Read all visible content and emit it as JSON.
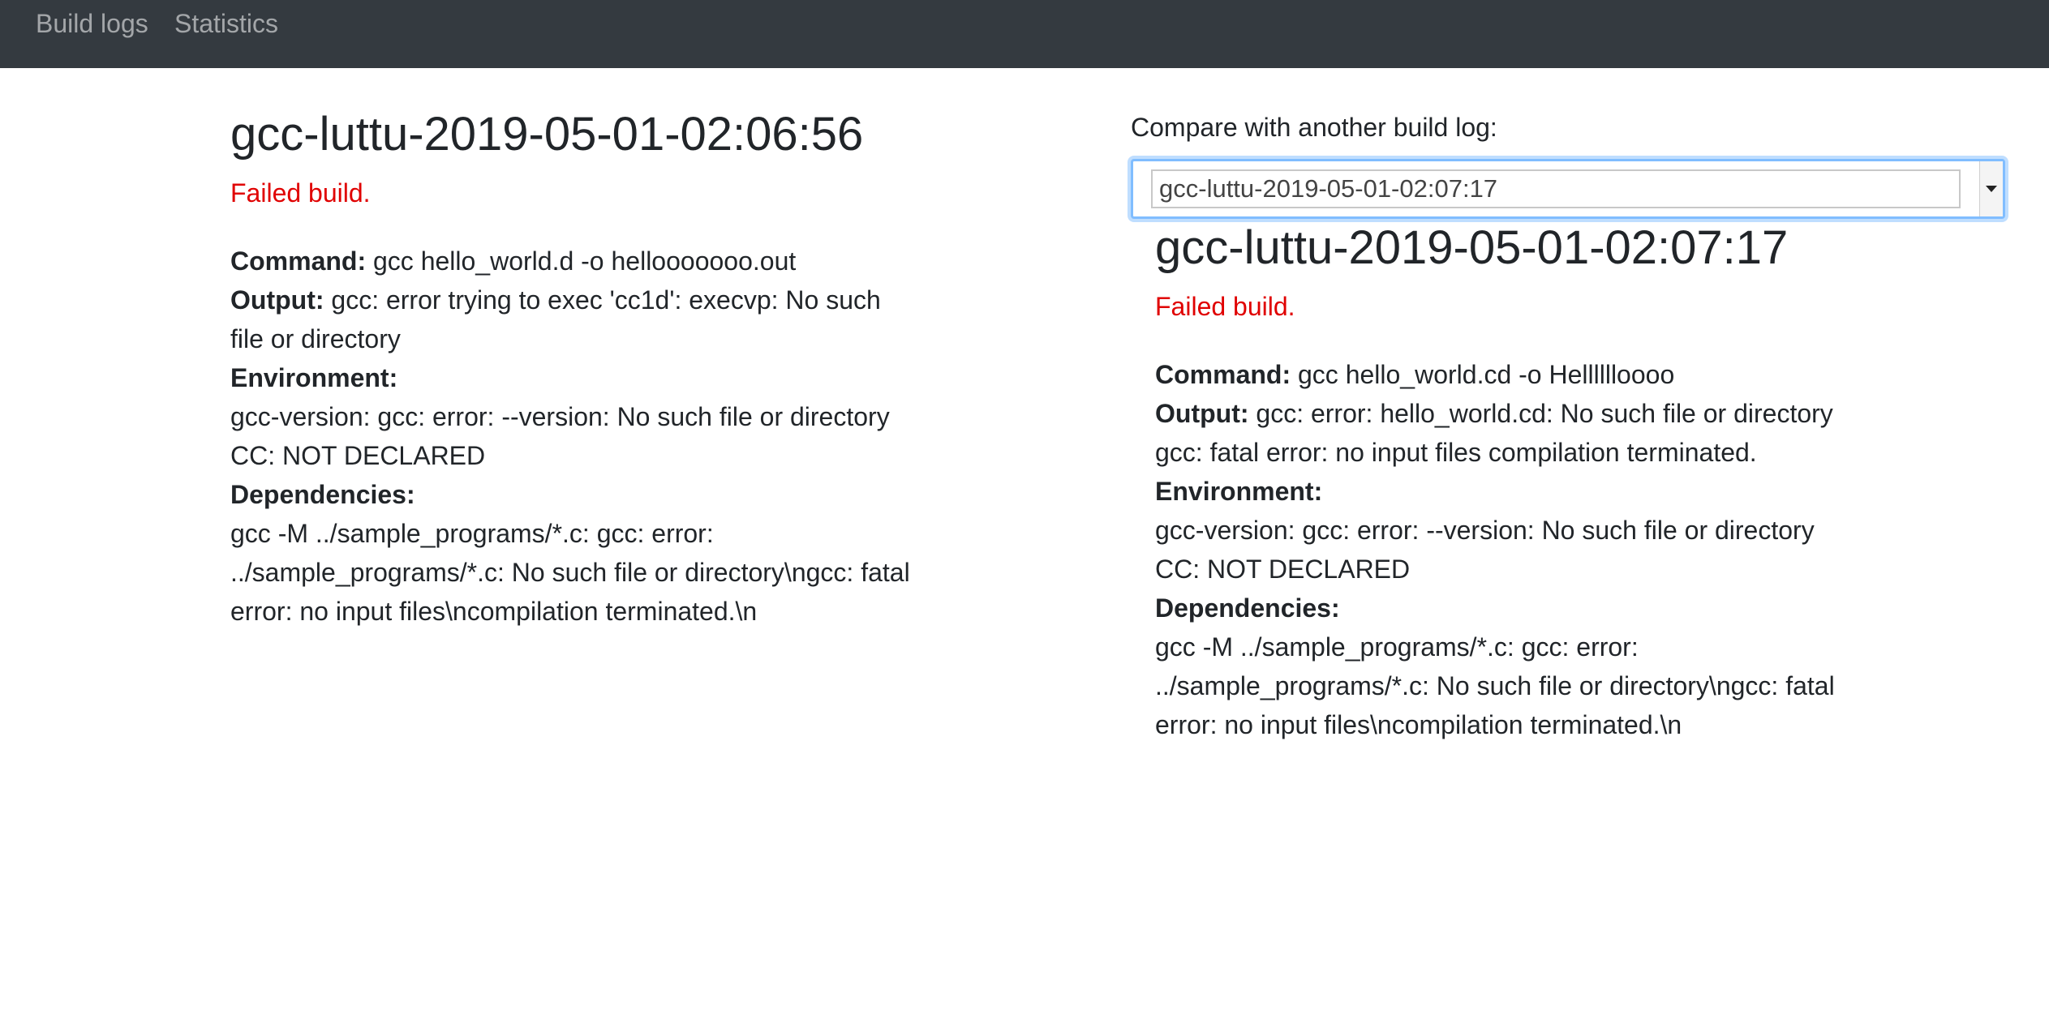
{
  "nav": {
    "build_logs": "Build logs",
    "statistics": "Statistics"
  },
  "left_log": {
    "title": "gcc-luttu-2019-05-01-02:06:56",
    "status": "Failed build.",
    "command_label": "Command:",
    "command": " gcc hello_world.d -o hellooooooo.out",
    "output_label": "Output:",
    "output": " gcc: error trying to exec 'cc1d': execvp: No such file or directory",
    "environment_label": "Environment:",
    "env_gcc_version": "gcc-version: gcc: error: --version: No such file or directory",
    "env_cc": "CC: NOT DECLARED",
    "dependencies_label": "Dependencies:",
    "dependencies": "gcc -M ../sample_programs/*.c: gcc: error: ../sample_programs/*.c: No such file or directory\\ngcc: fatal error: no input files\\ncompilation terminated.\\n"
  },
  "compare": {
    "label": "Compare with another build log:",
    "selected": "gcc-luttu-2019-05-01-02:07:17"
  },
  "right_log": {
    "title": "gcc-luttu-2019-05-01-02:07:17",
    "status": "Failed build.",
    "command_label": "Command:",
    "command": " gcc hello_world.cd -o Helllllloooo",
    "output_label": "Output:",
    "output": " gcc: error: hello_world.cd: No such file or directory gcc: fatal error: no input files compilation terminated.",
    "environment_label": "Environment:",
    "env_gcc_version": "gcc-version: gcc: error: --version: No such file or directory",
    "env_cc": "CC: NOT DECLARED",
    "dependencies_label": "Dependencies:",
    "dependencies": "gcc -M ../sample_programs/*.c: gcc: error: ../sample_programs/*.c: No such file or directory\\ngcc: fatal error: no input files\\ncompilation terminated.\\n"
  },
  "colors": {
    "navbar": "#343a40",
    "error": "#e00000",
    "focus": "#80bdff"
  }
}
